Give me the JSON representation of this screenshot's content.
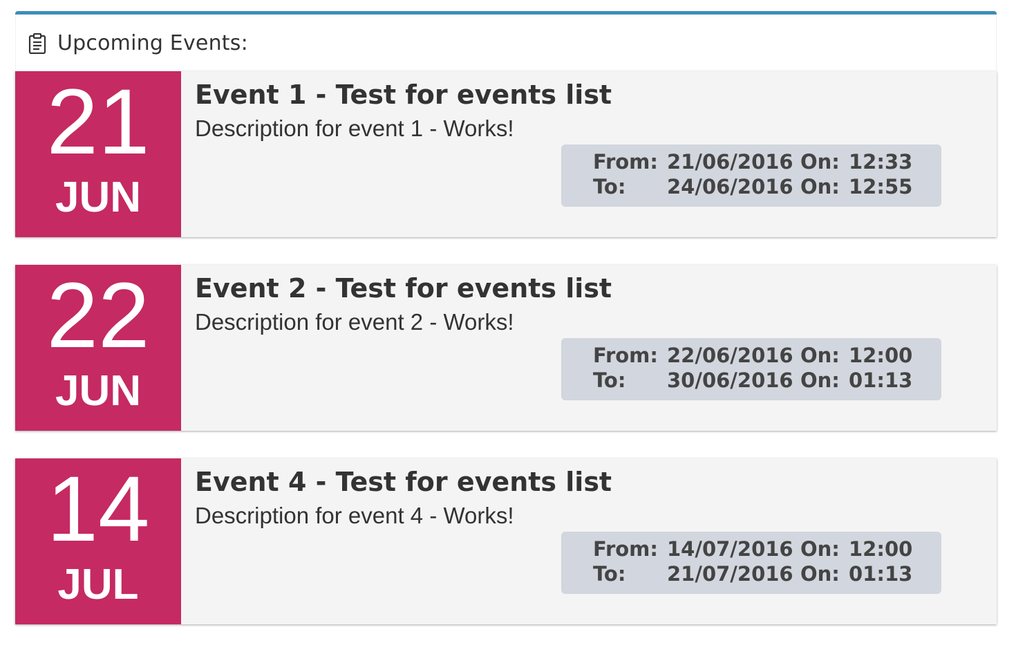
{
  "header": {
    "icon": "clipboard-icon",
    "title": "Upcoming Events:"
  },
  "colors": {
    "accent": "#3c8dbc",
    "date_box": "#c52a62",
    "card_bg": "#f4f4f4",
    "time_box": "#d2d6de"
  },
  "events": [
    {
      "day": "21",
      "month": "JUN",
      "title": "Event 1 - Test for events list",
      "description": "Description for event 1 - Works!",
      "from_label": "From:",
      "from_date": "21/06/2016",
      "from_on_label": "On:",
      "from_time": "12:33",
      "to_label": "To:",
      "to_date": "24/06/2016",
      "to_on_label": "On:",
      "to_time": "12:55"
    },
    {
      "day": "22",
      "month": "JUN",
      "title": "Event 2 - Test for events list",
      "description": "Description for event 2 - Works!",
      "from_label": "From:",
      "from_date": "22/06/2016",
      "from_on_label": "On:",
      "from_time": "12:00",
      "to_label": "To:",
      "to_date": "30/06/2016",
      "to_on_label": "On:",
      "to_time": "01:13"
    },
    {
      "day": "14",
      "month": "JUL",
      "title": "Event 4 - Test for events list",
      "description": "Description for event 4 - Works!",
      "from_label": "From:",
      "from_date": "14/07/2016",
      "from_on_label": "On:",
      "from_time": "12:00",
      "to_label": "To:",
      "to_date": "21/07/2016",
      "to_on_label": "On:",
      "to_time": "01:13"
    }
  ]
}
